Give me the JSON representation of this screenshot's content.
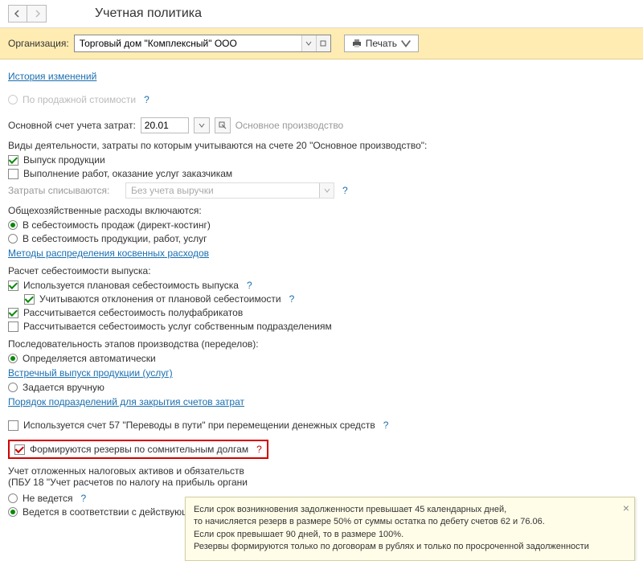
{
  "header": {
    "title": "Учетная политика"
  },
  "org": {
    "label": "Организация:",
    "value": "Торговый дом \"Комплексный\" ООО",
    "print_label": "Печать"
  },
  "links": {
    "history": "История изменений",
    "indirect_methods": "Методы распределения косвенных расходов",
    "counter_output": "Встречный выпуск продукции (услуг)",
    "close_order": "Порядок подразделений для закрытия счетов затрат"
  },
  "radios": {
    "sales_cost": "По продажной стоимости",
    "overhead_direct": "В себестоимость продаж (директ-костинг)",
    "overhead_prod": "В себестоимость продукции, работ, услуг",
    "stages_auto": "Определяется автоматически",
    "stages_manual": "Задается вручную",
    "pbu_current": "Ведется в соответствии с действующей редакцией ПБУ"
  },
  "fields": {
    "main_account_label": "Основной счет учета затрат:",
    "main_account_value": "20.01",
    "main_account_desc": "Основное производство",
    "activities_label": "Виды деятельности, затраты по которым учитываются на счете 20 \"Основное производство\":",
    "writeoff_label": "Затраты списываются:",
    "writeoff_value": "Без учета выручки",
    "overhead_label": "Общехозяйственные расходы включаются:",
    "cost_calc_label": "Расчет себестоимости выпуска:",
    "stages_label": "Последовательность этапов производства (переделов):",
    "deferred_label": "Учет отложенных налоговых активов и обязательств",
    "deferred_sub": "(ПБУ 18 \"Учет расчетов по налогу на прибыль органи",
    "not_kept": "Не ведется"
  },
  "checks": {
    "product_output": "Выпуск продукции",
    "work_services": "Выполнение работ, оказание услуг заказчикам",
    "planned_cost": "Используется плановая себестоимость выпуска",
    "deviations": "Учитываются отклонения от плановой себестоимости",
    "semi_finished": "Рассчитывается себестоимость полуфабрикатов",
    "own_services": "Рассчитывается себестоимость услуг собственным подразделениям",
    "account57": "Используется счет 57 \"Переводы в пути\" при перемещении денежных средств",
    "doubtful_reserves": "Формируются резервы по сомнительным долгам"
  },
  "tooltip": {
    "l1": "Если срок возникновения задолженности превышает 45 календарных дней,",
    "l2": "то начисляется резерв в размере 50% от суммы остатка по дебету счетов 62 и 76.06.",
    "l3": "Если срок превышает 90 дней, то в размере 100%.",
    "l4": "Резервы формируются только по договорам в рублях и только по просроченной задолженности"
  }
}
